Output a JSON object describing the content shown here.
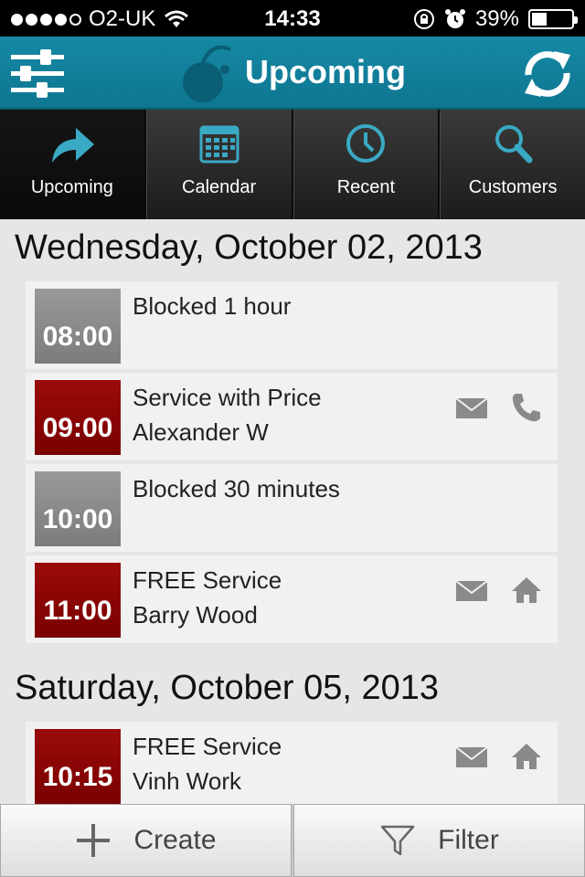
{
  "status_bar": {
    "carrier": "O2-UK",
    "time": "14:33",
    "battery": "39%",
    "battery_level": 0.39
  },
  "header": {
    "title": "Upcoming",
    "settings_icon": "sliders-icon",
    "refresh_icon": "refresh-icon"
  },
  "tabs": [
    {
      "label": "Upcoming",
      "icon": "forward-arrow-icon",
      "active": true
    },
    {
      "label": "Calendar",
      "icon": "calendar-icon",
      "active": false
    },
    {
      "label": "Recent",
      "icon": "clock-icon",
      "active": false
    },
    {
      "label": "Customers",
      "icon": "search-icon",
      "active": false
    }
  ],
  "days": [
    {
      "heading": "Wednesday, October 02, 2013",
      "appointments": [
        {
          "time": "08:00",
          "line1": "Blocked 1 hour",
          "line2": "",
          "status": "blocked",
          "actions": []
        },
        {
          "time": "09:00",
          "line1": "Service with Price",
          "line2": "Alexander W",
          "status": "booked",
          "actions": [
            "mail-icon",
            "phone-icon"
          ]
        },
        {
          "time": "10:00",
          "line1": "Blocked 30 minutes",
          "line2": "",
          "status": "blocked",
          "actions": []
        },
        {
          "time": "11:00",
          "line1": "FREE Service",
          "line2": "Barry Wood",
          "status": "booked",
          "actions": [
            "mail-icon",
            "home-icon"
          ]
        }
      ]
    },
    {
      "heading": "Saturday, October 05, 2013",
      "appointments": [
        {
          "time": "10:15",
          "line1": "FREE Service",
          "line2": "Vinh Work",
          "status": "booked",
          "actions": [
            "mail-icon",
            "home-icon"
          ]
        }
      ]
    }
  ],
  "bottom_bar": {
    "create_label": "Create",
    "filter_label": "Filter"
  },
  "colors": {
    "header": "#1689a5",
    "accent": "#3aa9c4",
    "booked": "#8b0000",
    "blocked": "#8c8c8c"
  }
}
